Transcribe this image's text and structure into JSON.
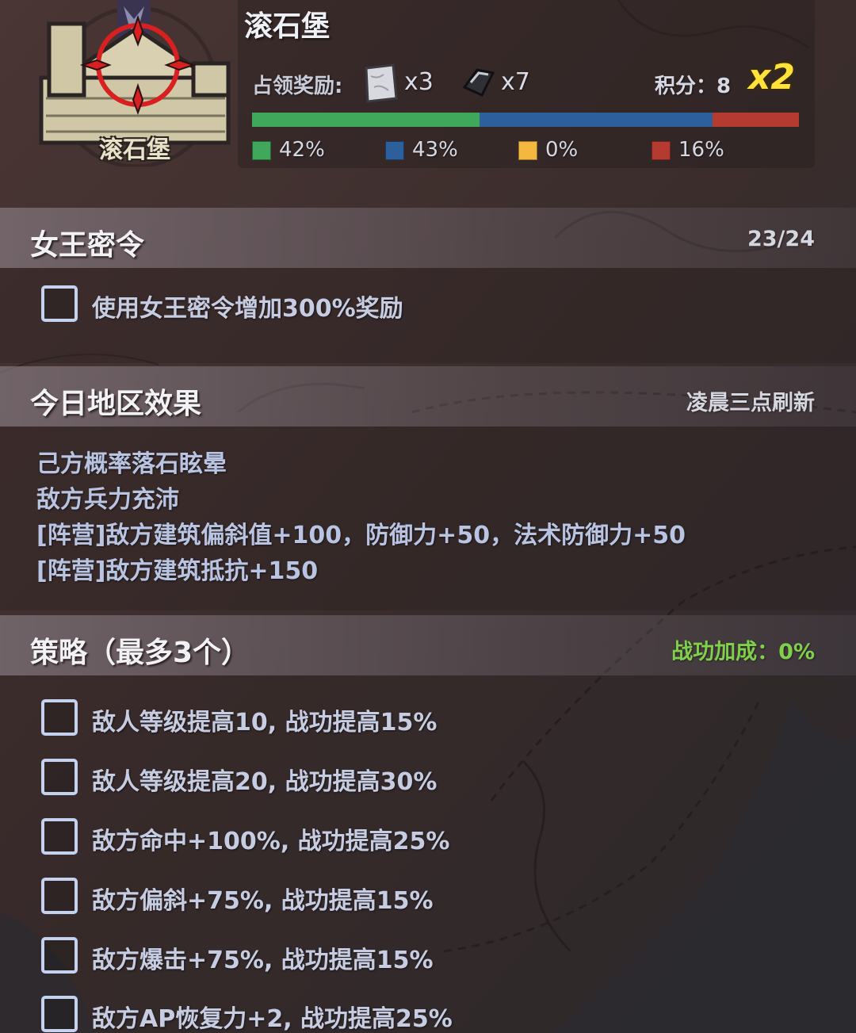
{
  "header": {
    "title": "滚石堡",
    "castle_name": "滚石堡",
    "reward_label": "占领奖励:",
    "rewards": [
      {
        "icon": "stone-block-icon",
        "qty": "x3"
      },
      {
        "icon": "metal-ingot-icon",
        "qty": "x7"
      }
    ],
    "score": "积分：8",
    "multiplier": "x2",
    "occupation": [
      {
        "label": "42%",
        "value": 42,
        "color": "#3fa85a"
      },
      {
        "label": "43%",
        "value": 43,
        "color": "#2d5f9c"
      },
      {
        "label": "0%",
        "value": 0,
        "color": "#f4b740"
      },
      {
        "label": "16%",
        "value": 16,
        "color": "#b53a30"
      }
    ]
  },
  "queen_order": {
    "title": "女王密令",
    "count": "23/24",
    "option": "使用女王密令增加300%奖励"
  },
  "region_effects": {
    "title": "今日地区效果",
    "refresh": "凌晨三点刷新",
    "items": [
      "己方概率落石眩晕",
      "敌方兵力充沛",
      "[阵营]敌方建筑偏斜值+100，防御力+50，法术防御力+50",
      "[阵营]敌方建筑抵抗+150"
    ]
  },
  "strategy": {
    "title": "策略（最多3个）",
    "bonus": "战功加成：0%",
    "options": [
      "敌人等级提高10, 战功提高15%",
      "敌人等级提高20, 战功提高30%",
      "敌方命中+100%, 战功提高25%",
      "敌方偏斜+75%, 战功提高15%",
      "敌方爆击+75%, 战功提高15%",
      "敌方AP恢复力+2, 战功提高25%"
    ]
  }
}
